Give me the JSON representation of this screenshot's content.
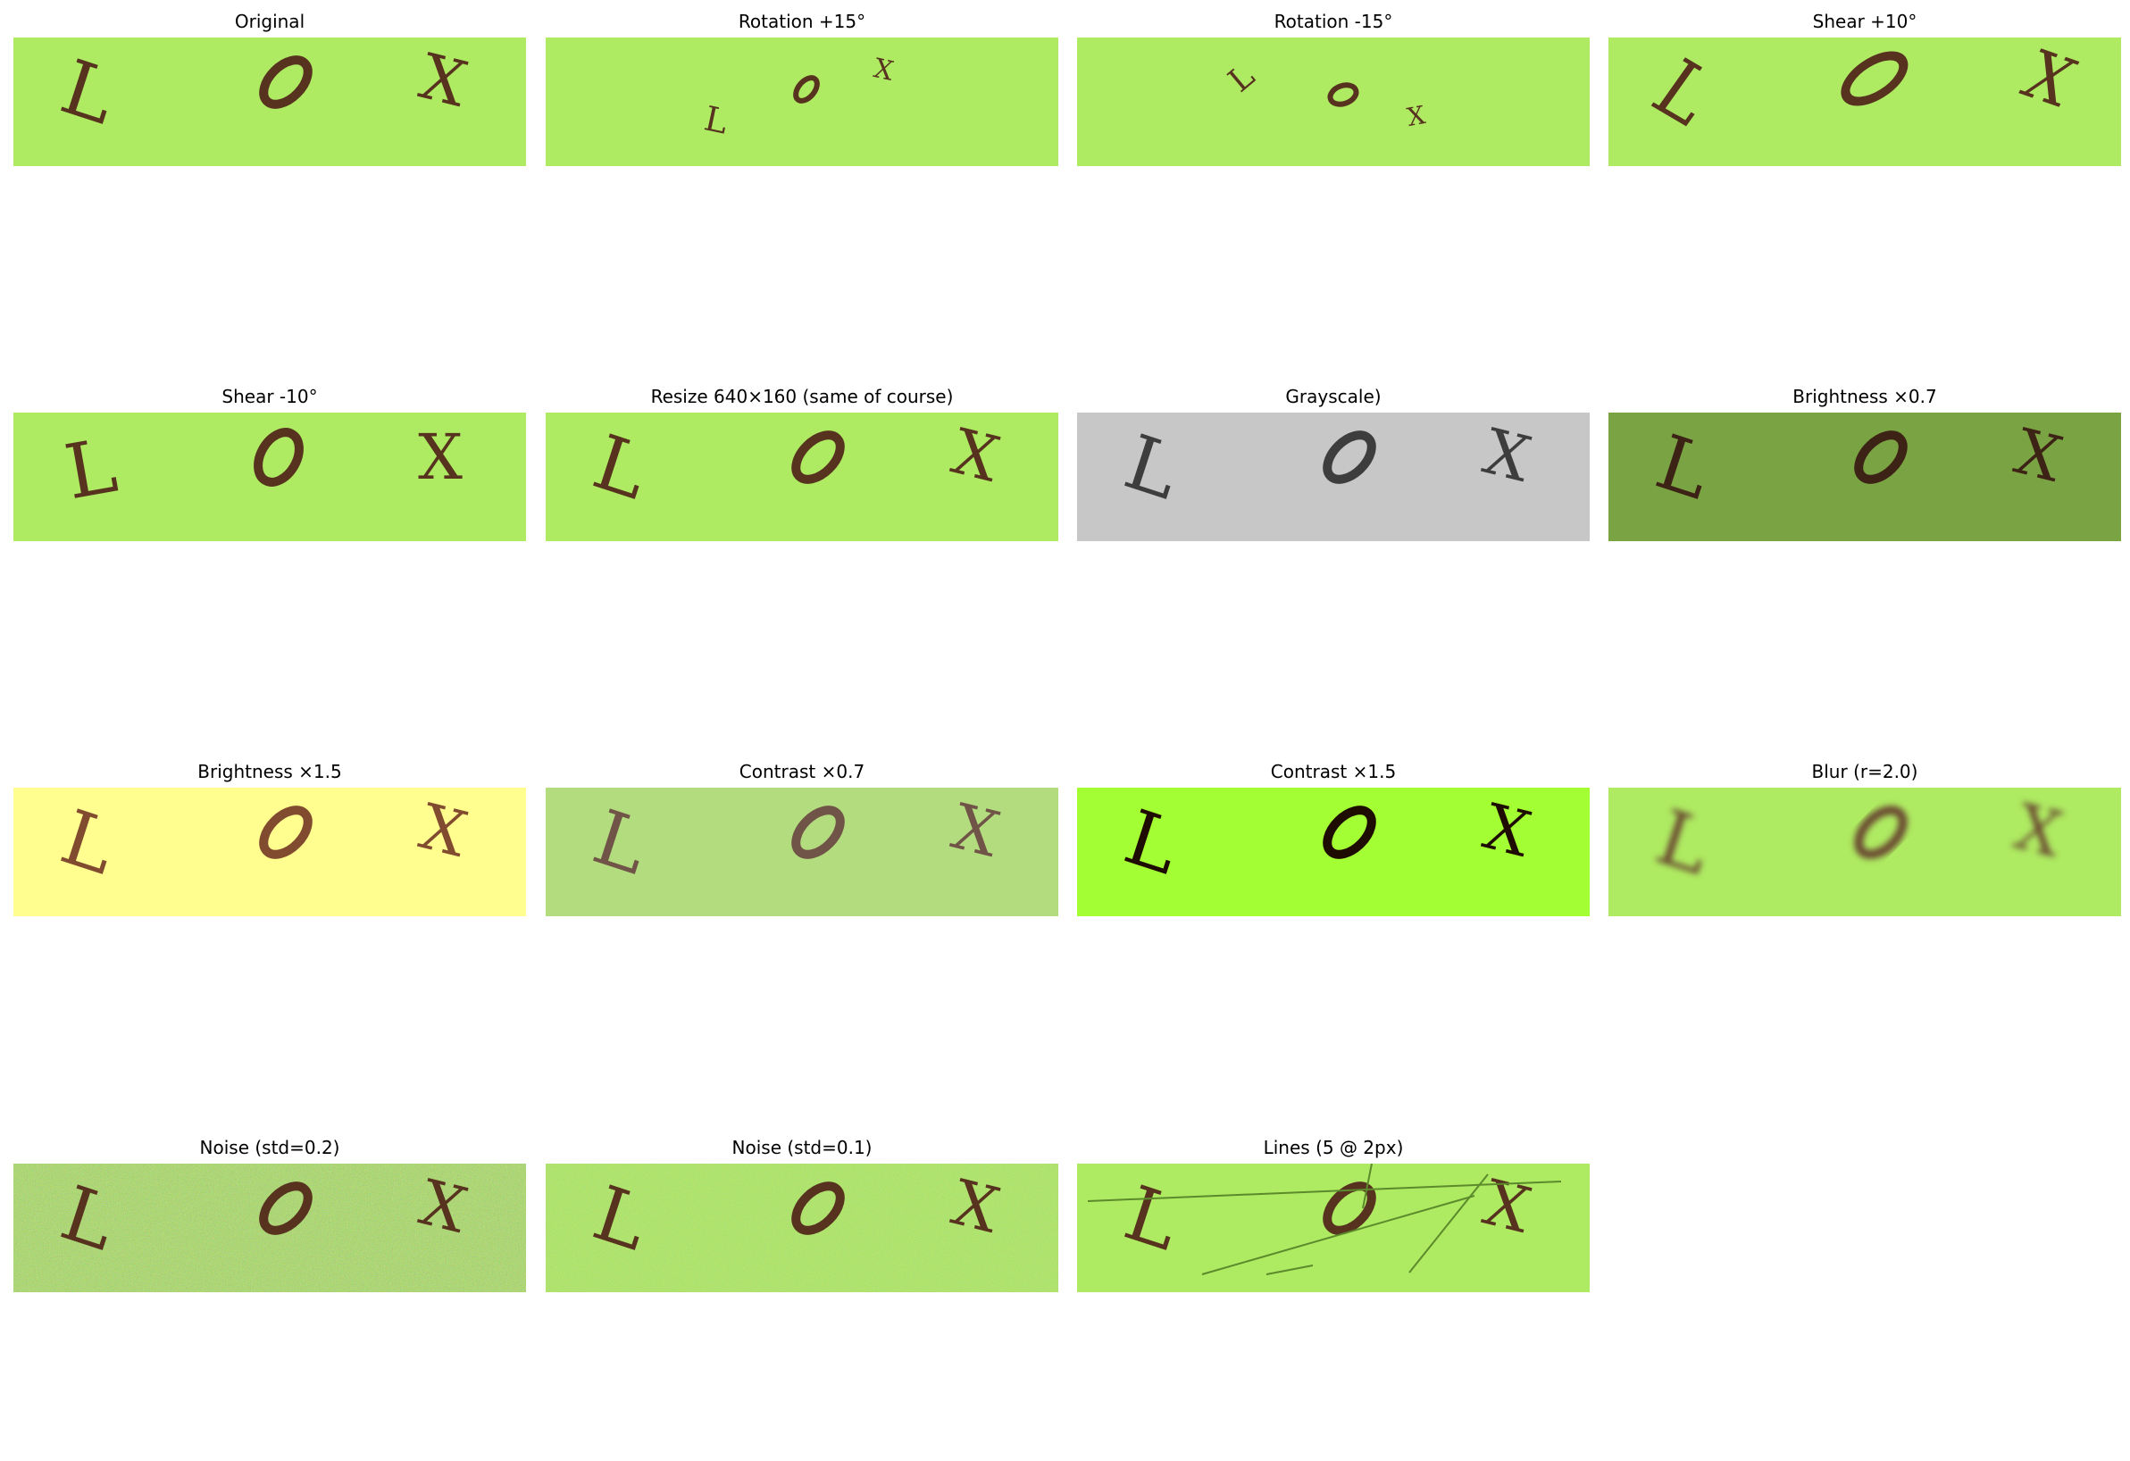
{
  "letters": [
    "L",
    "O",
    "X"
  ],
  "panels": [
    {
      "title": "Original",
      "bg": "#aeea62",
      "ink": "#56321f",
      "variant": "normal"
    },
    {
      "title": "Rotation +15°",
      "bg": "#aeea62",
      "ink": "#56321f",
      "variant": "rot_pos"
    },
    {
      "title": "Rotation -15°",
      "bg": "#aeea62",
      "ink": "#56321f",
      "variant": "rot_neg"
    },
    {
      "title": "Shear +10°",
      "bg": "#aeea62",
      "ink": "#56321f",
      "variant": "shear_pos"
    },
    {
      "title": "Shear -10°",
      "bg": "#aeea62",
      "ink": "#56321f",
      "variant": "shear_neg"
    },
    {
      "title": "Resize 640×160 (same of course)",
      "bg": "#aeea62",
      "ink": "#56321f",
      "variant": "normal"
    },
    {
      "title": "Grayscale)",
      "bg": "#c7c7c7",
      "ink": "#3d3d3d",
      "variant": "normal"
    },
    {
      "title": "Brightness ×0.7",
      "bg": "#7aa344",
      "ink": "#3c2315",
      "variant": "normal"
    },
    {
      "title": "Brightness ×1.5",
      "bg": "#fffe8e",
      "ink": "#814b2f",
      "variant": "normal"
    },
    {
      "title": "Contrast ×0.7",
      "bg": "#b3dc7f",
      "ink": "#705448",
      "variant": "normal"
    },
    {
      "title": "Contrast ×1.5",
      "bg": "#a3ff33",
      "ink": "#1e0c00",
      "variant": "normal"
    },
    {
      "title": "Blur (r=2.0)",
      "bg": "#aeea62",
      "ink": "#6a4a31",
      "variant": "blur"
    },
    {
      "title": "Noise (std=0.2)",
      "bg": "#a9e05f",
      "ink": "#56321f",
      "variant": "noise_heavy"
    },
    {
      "title": "Noise (std=0.1)",
      "bg": "#aeea62",
      "ink": "#56321f",
      "variant": "noise_light"
    },
    {
      "title": "Lines (5 @ 2px)",
      "bg": "#aeea62",
      "ink": "#56321f",
      "variant": "lines",
      "line_color": "#5c8a2c"
    }
  ]
}
